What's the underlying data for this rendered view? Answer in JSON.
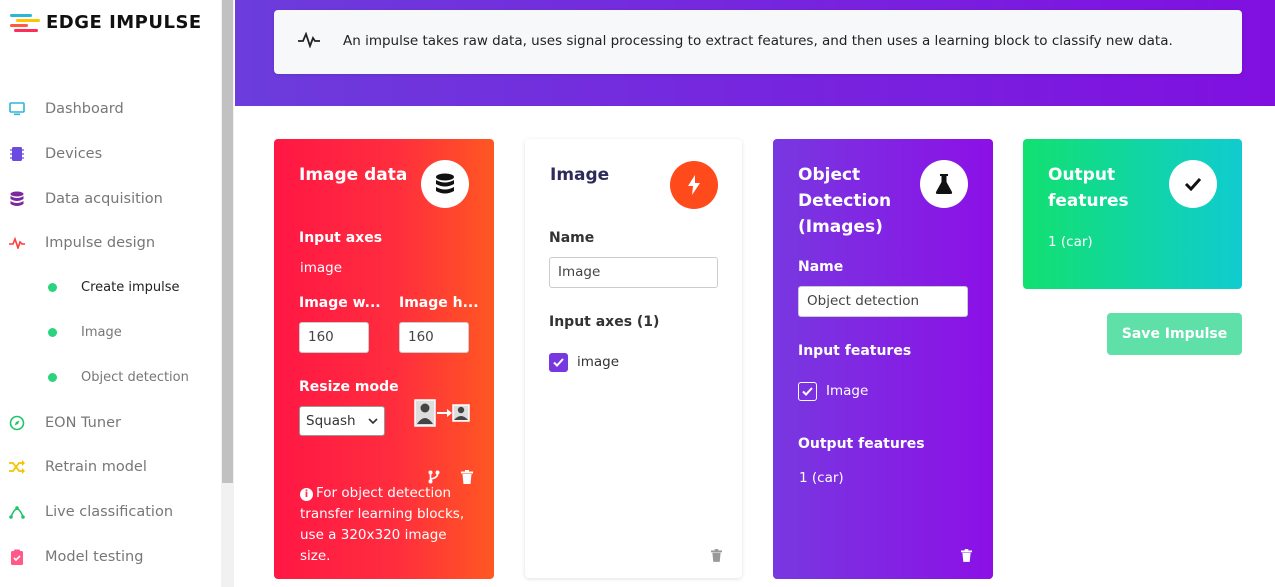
{
  "brand": {
    "name": "EDGE IMPULSE"
  },
  "sidebar": {
    "items": [
      {
        "label": "Dashboard",
        "icon": "monitor-icon",
        "color": "#2bb6d6"
      },
      {
        "label": "Devices",
        "icon": "chip-icon",
        "color": "#6a4adf"
      },
      {
        "label": "Data acquisition",
        "icon": "database-icon",
        "color": "#7b2a9e"
      },
      {
        "label": "Impulse design",
        "icon": "pulse-icon",
        "color": "#ff3d3d"
      },
      {
        "label": "EON Tuner",
        "icon": "compass-icon",
        "color": "#1fc46b"
      },
      {
        "label": "Retrain model",
        "icon": "shuffle-icon",
        "color": "#f5c400"
      },
      {
        "label": "Live classification",
        "icon": "curve-icon",
        "color": "#1fc46b"
      },
      {
        "label": "Model testing",
        "icon": "clipboard-check-icon",
        "color": "#ff5a8a"
      }
    ],
    "subitems": [
      {
        "label": "Create impulse",
        "active": true
      },
      {
        "label": "Image",
        "active": false
      },
      {
        "label": "Object detection",
        "active": false
      }
    ]
  },
  "banner": {
    "text": "An impulse takes raw data, uses signal processing to extract features, and then uses a learning block to classify new data."
  },
  "image_data_block": {
    "title": "Image data",
    "input_axes_label": "Input axes",
    "input_axes_value": "image",
    "width_label": "Image w...",
    "width_value": "160",
    "height_label": "Image h...",
    "height_value": "160",
    "resize_label": "Resize mode",
    "resize_value": "Squash",
    "note": "For object detection transfer learning blocks, use a 320x320 image size."
  },
  "image_block": {
    "title": "Image",
    "name_label": "Name",
    "name_value": "Image",
    "input_axes_label": "Input axes (1)",
    "axis_item": "image"
  },
  "od_block": {
    "title_line1": "Object",
    "title_line2": "Detection",
    "title_line3": "(Images)",
    "name_label": "Name",
    "name_value": "Object detection",
    "input_features_label": "Input features",
    "feature_item": "Image",
    "output_features_label": "Output features",
    "output_value": "1 (car)"
  },
  "output_block": {
    "title_line1": "Output",
    "title_line2": "features",
    "value": "1 (car)"
  },
  "actions": {
    "save_label": "Save Impulse"
  },
  "colors": {
    "accent_purple": "#8010e0",
    "image_data_red": "#ff1744",
    "image_block_orange": "#ff5722",
    "output_green": "#12e070",
    "save_button": "#5fe0a8"
  }
}
